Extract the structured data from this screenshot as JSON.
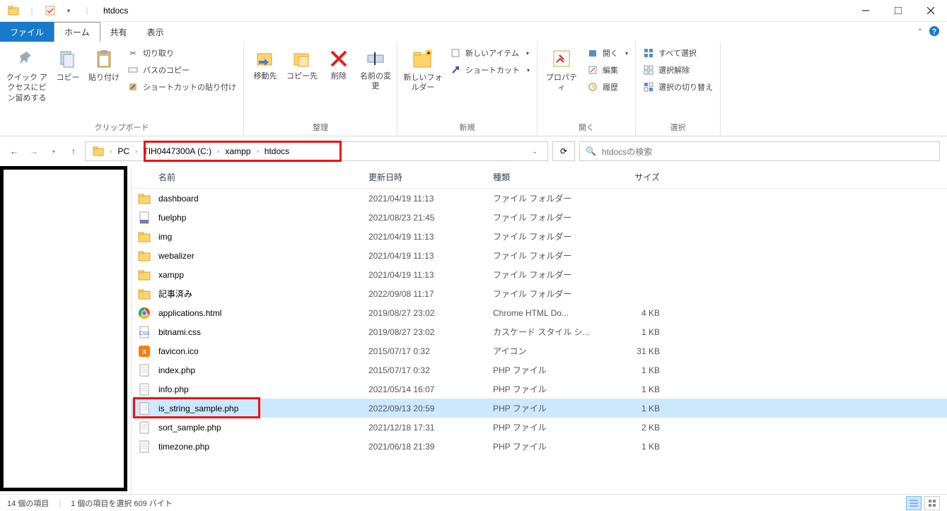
{
  "window": {
    "title": "htdocs"
  },
  "tabs": {
    "file": "ファイル",
    "home": "ホーム",
    "share": "共有",
    "view": "表示"
  },
  "ribbon": {
    "clipboard": {
      "label": "クリップボード",
      "pin": "クイック アクセスにピン留めする",
      "copy": "コピー",
      "paste": "貼り付け",
      "cut": "切り取り",
      "copy_path": "パスのコピー",
      "paste_shortcut": "ショートカットの貼り付け"
    },
    "organize": {
      "label": "整理",
      "move_to": "移動先",
      "copy_to": "コピー先",
      "delete": "削除",
      "rename": "名前の変更"
    },
    "new": {
      "label": "新規",
      "new_folder": "新しいフォルダー",
      "new_item": "新しいアイテム",
      "shortcut": "ショートカット"
    },
    "open": {
      "label": "開く",
      "properties": "プロパティ",
      "open": "開く",
      "edit": "編集",
      "history": "履歴"
    },
    "select": {
      "label": "選択",
      "select_all": "すべて選択",
      "select_none": "選択解除",
      "invert": "選択の切り替え"
    }
  },
  "breadcrumb": {
    "pc": "PC",
    "drive": "TIH0447300A (C:)",
    "folder1": "xampp",
    "folder2": "htdocs"
  },
  "search": {
    "placeholder": "htdocsの検索"
  },
  "columns": {
    "name": "名前",
    "date": "更新日時",
    "type": "種類",
    "size": "サイズ"
  },
  "files": [
    {
      "icon": "folder",
      "name": "dashboard",
      "date": "2021/04/19 11:13",
      "type": "ファイル フォルダー",
      "size": ""
    },
    {
      "icon": "file-php",
      "name": "fuelphp",
      "date": "2021/08/23 21:45",
      "type": "ファイル フォルダー",
      "size": ""
    },
    {
      "icon": "folder",
      "name": "img",
      "date": "2021/04/19 11:13",
      "type": "ファイル フォルダー",
      "size": ""
    },
    {
      "icon": "folder",
      "name": "webalizer",
      "date": "2021/04/19 11:13",
      "type": "ファイル フォルダー",
      "size": ""
    },
    {
      "icon": "folder",
      "name": "xampp",
      "date": "2021/04/19 11:13",
      "type": "ファイル フォルダー",
      "size": ""
    },
    {
      "icon": "folder",
      "name": "記事済み",
      "date": "2022/09/08 11:17",
      "type": "ファイル フォルダー",
      "size": ""
    },
    {
      "icon": "chrome",
      "name": "applications.html",
      "date": "2019/08/27 23:02",
      "type": "Chrome HTML Do...",
      "size": "4 KB"
    },
    {
      "icon": "css",
      "name": "bitnami.css",
      "date": "2019/08/27 23:02",
      "type": "カスケード スタイル シ...",
      "size": "1 KB"
    },
    {
      "icon": "favicon",
      "name": "favicon.ico",
      "date": "2015/07/17 0:32",
      "type": "アイコン",
      "size": "31 KB"
    },
    {
      "icon": "file",
      "name": "index.php",
      "date": "2015/07/17 0:32",
      "type": "PHP ファイル",
      "size": "1 KB"
    },
    {
      "icon": "file",
      "name": "info.php",
      "date": "2021/05/14 16:07",
      "type": "PHP ファイル",
      "size": "1 KB"
    },
    {
      "icon": "file",
      "name": "is_string_sample.php",
      "date": "2022/09/13 20:59",
      "type": "PHP ファイル",
      "size": "1 KB",
      "selected": true,
      "highlighted": true
    },
    {
      "icon": "file",
      "name": "sort_sample.php",
      "date": "2021/12/18 17:31",
      "type": "PHP ファイル",
      "size": "2 KB"
    },
    {
      "icon": "file",
      "name": "timezone.php",
      "date": "2021/06/18 21:39",
      "type": "PHP ファイル",
      "size": "1 KB"
    }
  ],
  "status": {
    "item_count": "14 個の項目",
    "selection": "1 個の項目を選択 609 バイト"
  }
}
